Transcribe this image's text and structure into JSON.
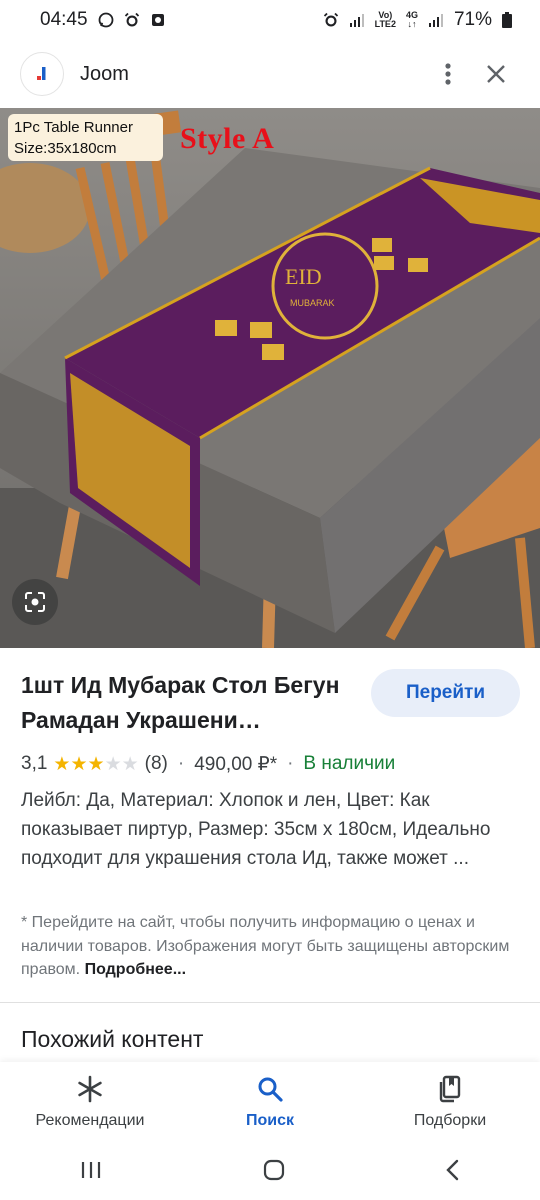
{
  "status_bar": {
    "time": "04:45",
    "battery": "71%",
    "net_volte": "Vo)",
    "net_lte": "LTE2",
    "net_4g": "4G"
  },
  "app_bar": {
    "title": "Joom",
    "favicon": "joom-logo-icon",
    "menu_icon": "more-vert-icon",
    "close_icon": "close-icon"
  },
  "image_overlay": {
    "tag_line1": "1Pc Table Runner",
    "tag_line2": "Size:35x180cm",
    "style_label": "Style A",
    "runner_text_eid": "EID",
    "runner_text_mubarak": "MUBARAK"
  },
  "product": {
    "title": "1шт Ид Мубарак Стол Бегун Рамадан Украшени…",
    "go_label": "Перейти",
    "rating_value": "3,1",
    "rating_stars_filled": 3,
    "rating_stars_total": 5,
    "review_count": "(8)",
    "price": "490,00 ₽*",
    "stock": "В наличии",
    "description": "Лейбл: Да, Материал: Хлопок и лен, Цвет: Как показывает пиртур, Размер: 35см x 180см, Идеально подходит для украшения стола Ид, также может ...",
    "disclaimer": "* Перейдите на сайт, чтобы получить информацию о ценах и наличии товаров. Изображения могут быть защищены авторским правом.",
    "more_link": "Подробнее..."
  },
  "similar": {
    "title": "Похожий контент"
  },
  "bottom_nav": {
    "items": [
      {
        "label": "Рекомендации",
        "icon": "asterisk-icon"
      },
      {
        "label": "Поиск",
        "icon": "search-icon"
      },
      {
        "label": "Подборки",
        "icon": "collections-icon"
      }
    ],
    "active_index": 1
  },
  "colors": {
    "accent": "#1a5fc8",
    "stock_green": "#188038",
    "star_gold": "#f4b400",
    "runner_purple": "#5b1d5e",
    "runner_gold": "#d6a21f",
    "tablecloth_gray": "#76726f",
    "overlay_red": "#e8101a"
  }
}
